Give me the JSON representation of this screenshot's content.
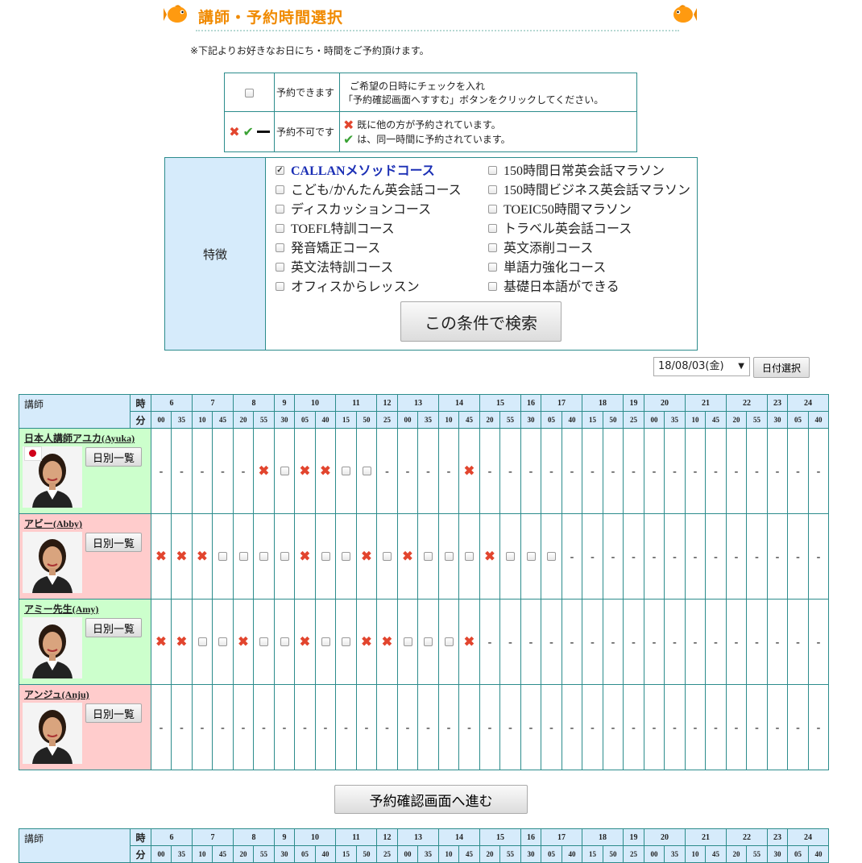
{
  "title": "講師・予約時間選択",
  "note": "※下記よりお好きなお日にち・時間をご予約頂けます。",
  "legend": {
    "available_label": "予約できます",
    "available_line1": "ご希望の日時にチェックを入れ",
    "available_line2": "「予約確認画面へすすむ」ボタンをクリックしてください。",
    "unavailable_label": "予約不可です",
    "unavailable_line1": "既に他の方が予約されています。",
    "unavailable_line2": "は、同一時間に予約されています。"
  },
  "feature": {
    "heading": "特徴",
    "col1": [
      {
        "label": "CALLANメソッドコース",
        "checked": true
      },
      {
        "label": "こども/かんたん英会話コース",
        "checked": false
      },
      {
        "label": "ディスカッションコース",
        "checked": false
      },
      {
        "label": "TOEFL特訓コース",
        "checked": false
      },
      {
        "label": "発音矯正コース",
        "checked": false
      },
      {
        "label": "英文法特訓コース",
        "checked": false
      },
      {
        "label": "オフィスからレッスン",
        "checked": false
      }
    ],
    "col2": [
      {
        "label": "150時間日常英会話マラソン",
        "checked": false
      },
      {
        "label": "150時間ビジネス英会話マラソン",
        "checked": false
      },
      {
        "label": "TOEIC50時間マラソン",
        "checked": false
      },
      {
        "label": "トラベル英会話コース",
        "checked": false
      },
      {
        "label": "英文添削コース",
        "checked": false
      },
      {
        "label": "単語力強化コース",
        "checked": false
      },
      {
        "label": "基礎日本語ができる",
        "checked": false
      }
    ],
    "search_button": "この条件で検索"
  },
  "date": {
    "selected": "18/08/03(金)",
    "button": "日付選択"
  },
  "schedule": {
    "teacher_header": "講師",
    "hour_label": "時",
    "minute_label": "分",
    "hours": [
      {
        "h": "6",
        "span": 2
      },
      {
        "h": "7",
        "span": 2
      },
      {
        "h": "8",
        "span": 2
      },
      {
        "h": "9",
        "span": 1
      },
      {
        "h": "10",
        "span": 2
      },
      {
        "h": "11",
        "span": 2
      },
      {
        "h": "12",
        "span": 1
      },
      {
        "h": "13",
        "span": 2
      },
      {
        "h": "14",
        "span": 2
      },
      {
        "h": "15",
        "span": 2
      },
      {
        "h": "16",
        "span": 1
      },
      {
        "h": "17",
        "span": 2
      },
      {
        "h": "18",
        "span": 2
      },
      {
        "h": "19",
        "span": 1
      },
      {
        "h": "20",
        "span": 2
      },
      {
        "h": "21",
        "span": 2
      },
      {
        "h": "22",
        "span": 2
      },
      {
        "h": "23",
        "span": 1
      },
      {
        "h": "24",
        "span": 2
      }
    ],
    "minutes": [
      "00",
      "35",
      "10",
      "45",
      "20",
      "55",
      "30",
      "05",
      "40",
      "15",
      "50",
      "25",
      "00",
      "35",
      "10",
      "45",
      "20",
      "55",
      "30",
      "05",
      "40",
      "15",
      "50",
      "25",
      "00",
      "35",
      "10",
      "45",
      "20",
      "55",
      "30",
      "05",
      "40"
    ],
    "day_button": "日別一覧",
    "teachers": [
      {
        "name": "日本人講師アユカ(Ayuka)",
        "bg": "green",
        "flag": true,
        "slots": [
          "-",
          "-",
          "-",
          "-",
          "-",
          "x",
          "o",
          "x",
          "x",
          "o",
          "o",
          "-",
          "-",
          "-",
          "-",
          "x",
          "-",
          "-",
          "-",
          "-",
          "-",
          "-",
          "-",
          "-",
          "-",
          "-",
          "-",
          "-",
          "-",
          "-",
          "-",
          "-",
          "-"
        ]
      },
      {
        "name": "アビー(Abby)",
        "bg": "pink",
        "flag": false,
        "slots": [
          "x",
          "x",
          "x",
          "o",
          "o",
          "o",
          "o",
          "x",
          "o",
          "o",
          "x",
          "o",
          "x",
          "o",
          "o",
          "o",
          "x",
          "o",
          "o",
          "o",
          "-",
          "-",
          "-",
          "-",
          "-",
          "-",
          "-",
          "-",
          "-",
          "-",
          "-",
          "-",
          "-"
        ]
      },
      {
        "name": "アミー先生(Amy)",
        "bg": "green",
        "flag": false,
        "slots": [
          "x",
          "x",
          "o",
          "o",
          "x",
          "o",
          "o",
          "x",
          "o",
          "o",
          "x",
          "x",
          "o",
          "o",
          "o",
          "x",
          "-",
          "-",
          "-",
          "-",
          "-",
          "-",
          "-",
          "-",
          "-",
          "-",
          "-",
          "-",
          "-",
          "-",
          "-",
          "-",
          "-"
        ]
      },
      {
        "name": "アンジュ(Anju)",
        "bg": "pink",
        "flag": false,
        "slots": [
          "-",
          "-",
          "-",
          "-",
          "-",
          "-",
          "-",
          "-",
          "-",
          "-",
          "-",
          "-",
          "-",
          "-",
          "-",
          "-",
          "-",
          "-",
          "-",
          "-",
          "-",
          "-",
          "-",
          "-",
          "-",
          "-",
          "-",
          "-",
          "-",
          "-",
          "-",
          "-",
          "-"
        ]
      }
    ]
  },
  "proceed_button": "予約確認画面へ進む",
  "colors": {
    "accent": "#f08a00",
    "border": "#2c8c8c",
    "header_bg": "#d6ebfb",
    "green_bg": "#ccffcc",
    "pink_bg": "#ffcccc",
    "x": "#e2452e",
    "check": "#3aa235"
  }
}
